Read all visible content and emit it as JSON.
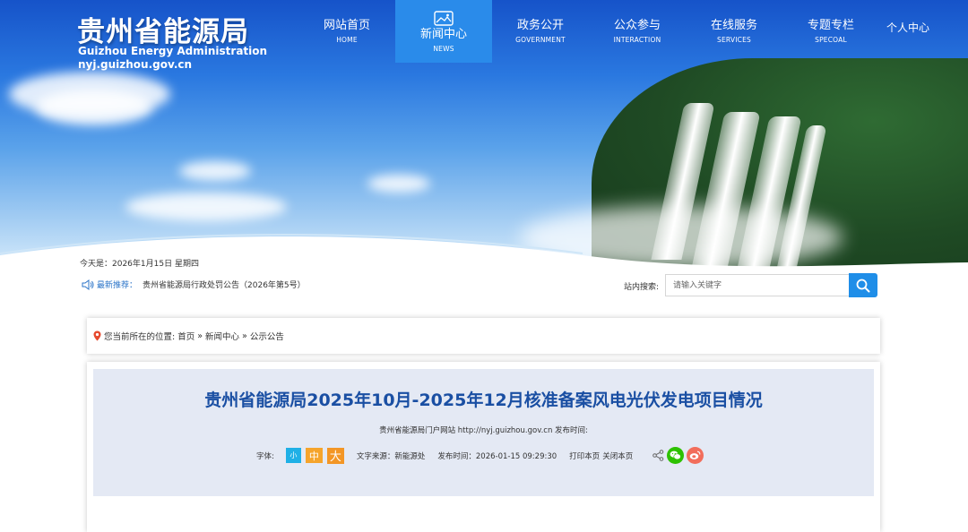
{
  "logo": {
    "name_cn": "贵州省能源局",
    "name_en": "Guizhou Energy Administration",
    "url": "nyj.guizhou.gov.cn"
  },
  "nav": {
    "items": [
      {
        "cn": "网站首页",
        "en": "HOME"
      },
      {
        "cn": "新闻中心",
        "en": "NEWS",
        "active": true,
        "icon": "image-icon"
      },
      {
        "cn": "政务公开",
        "en": "GOVERNMENT"
      },
      {
        "cn": "公众参与",
        "en": "INTERACTION"
      },
      {
        "cn": "在线服务",
        "en": "SERVICES"
      },
      {
        "cn": "专题专栏",
        "en": "SPECOAL"
      }
    ],
    "personal": "个人中心"
  },
  "info": {
    "today": "今天是：2026年1月15日 星期四",
    "rec_label": "最新推荐：",
    "rec_text": "贵州省能源局行政处罚公告（2026年第5号）"
  },
  "search": {
    "label": "站内搜索:",
    "placeholder": "请输入关键字"
  },
  "breadcrumb": {
    "prefix": "您当前所在的位置:",
    "items": [
      "首页",
      "新闻中心",
      "公示公告"
    ],
    "separator": "»"
  },
  "article": {
    "title": "贵州省能源局2025年10月-2025年12月核准备案风电光伏发电项目情况",
    "source_line": "贵州省能源局门户网站  http://nyj.guizhou.gov.cn  发布时间:",
    "font_label": "字体:",
    "font_sizes": [
      "小",
      "中",
      "大"
    ],
    "text_source": "文字来源：新能源处",
    "publish_time": "发布时间：2026-01-15 09:29:30",
    "print": "打印本页",
    "close": "关闭本页"
  },
  "colors": {
    "accent": "#2a8bea",
    "title_blue": "#1a4fa3",
    "search_button": "#1f8ee8",
    "font_small": "#1fb0e6",
    "font_medium": "#f5a42b",
    "font_large": "#f39625",
    "wechat": "#2dc100",
    "weibo": "#f26d5b"
  }
}
